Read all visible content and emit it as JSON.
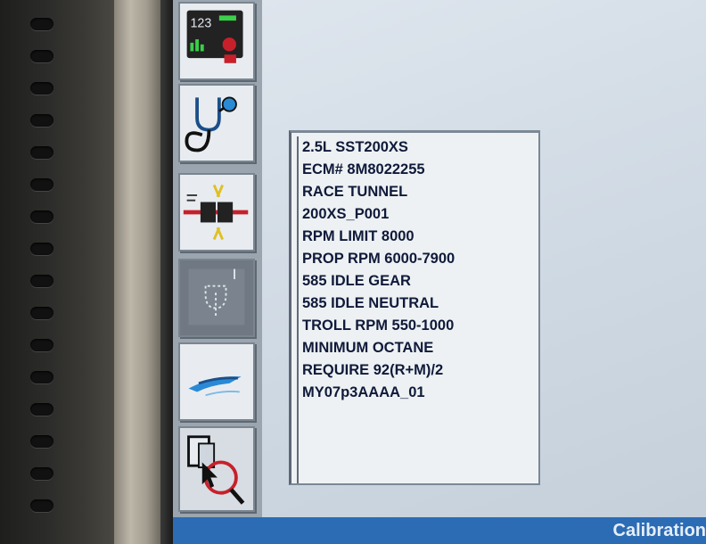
{
  "toolbar": {
    "buttons": [
      {
        "name": "data-display-icon",
        "display_value": "123"
      },
      {
        "name": "stethoscope-icon"
      },
      {
        "name": "connector-icon"
      },
      {
        "name": "module-icon"
      },
      {
        "name": "boat-icon"
      },
      {
        "name": "calibration-search-icon"
      }
    ]
  },
  "info": {
    "lines": [
      "2.5L SST200XS",
      "ECM# 8M8022255",
      "RACE TUNNEL",
      "200XS_P001",
      "RPM LIMIT 8000",
      "PROP RPM 6000-7900",
      "585 IDLE GEAR",
      "585 IDLE NEUTRAL",
      "TROLL RPM 550-1000",
      "MINIMUM OCTANE",
      "REQUIRE 92(R+M)/2",
      "MY07p3AAAA_01"
    ]
  },
  "status": {
    "label": "Calibration"
  },
  "colors": {
    "status_bar": "#2b6cb5",
    "text": "#0f1a3a",
    "toolbar": "#9aa5b0"
  }
}
